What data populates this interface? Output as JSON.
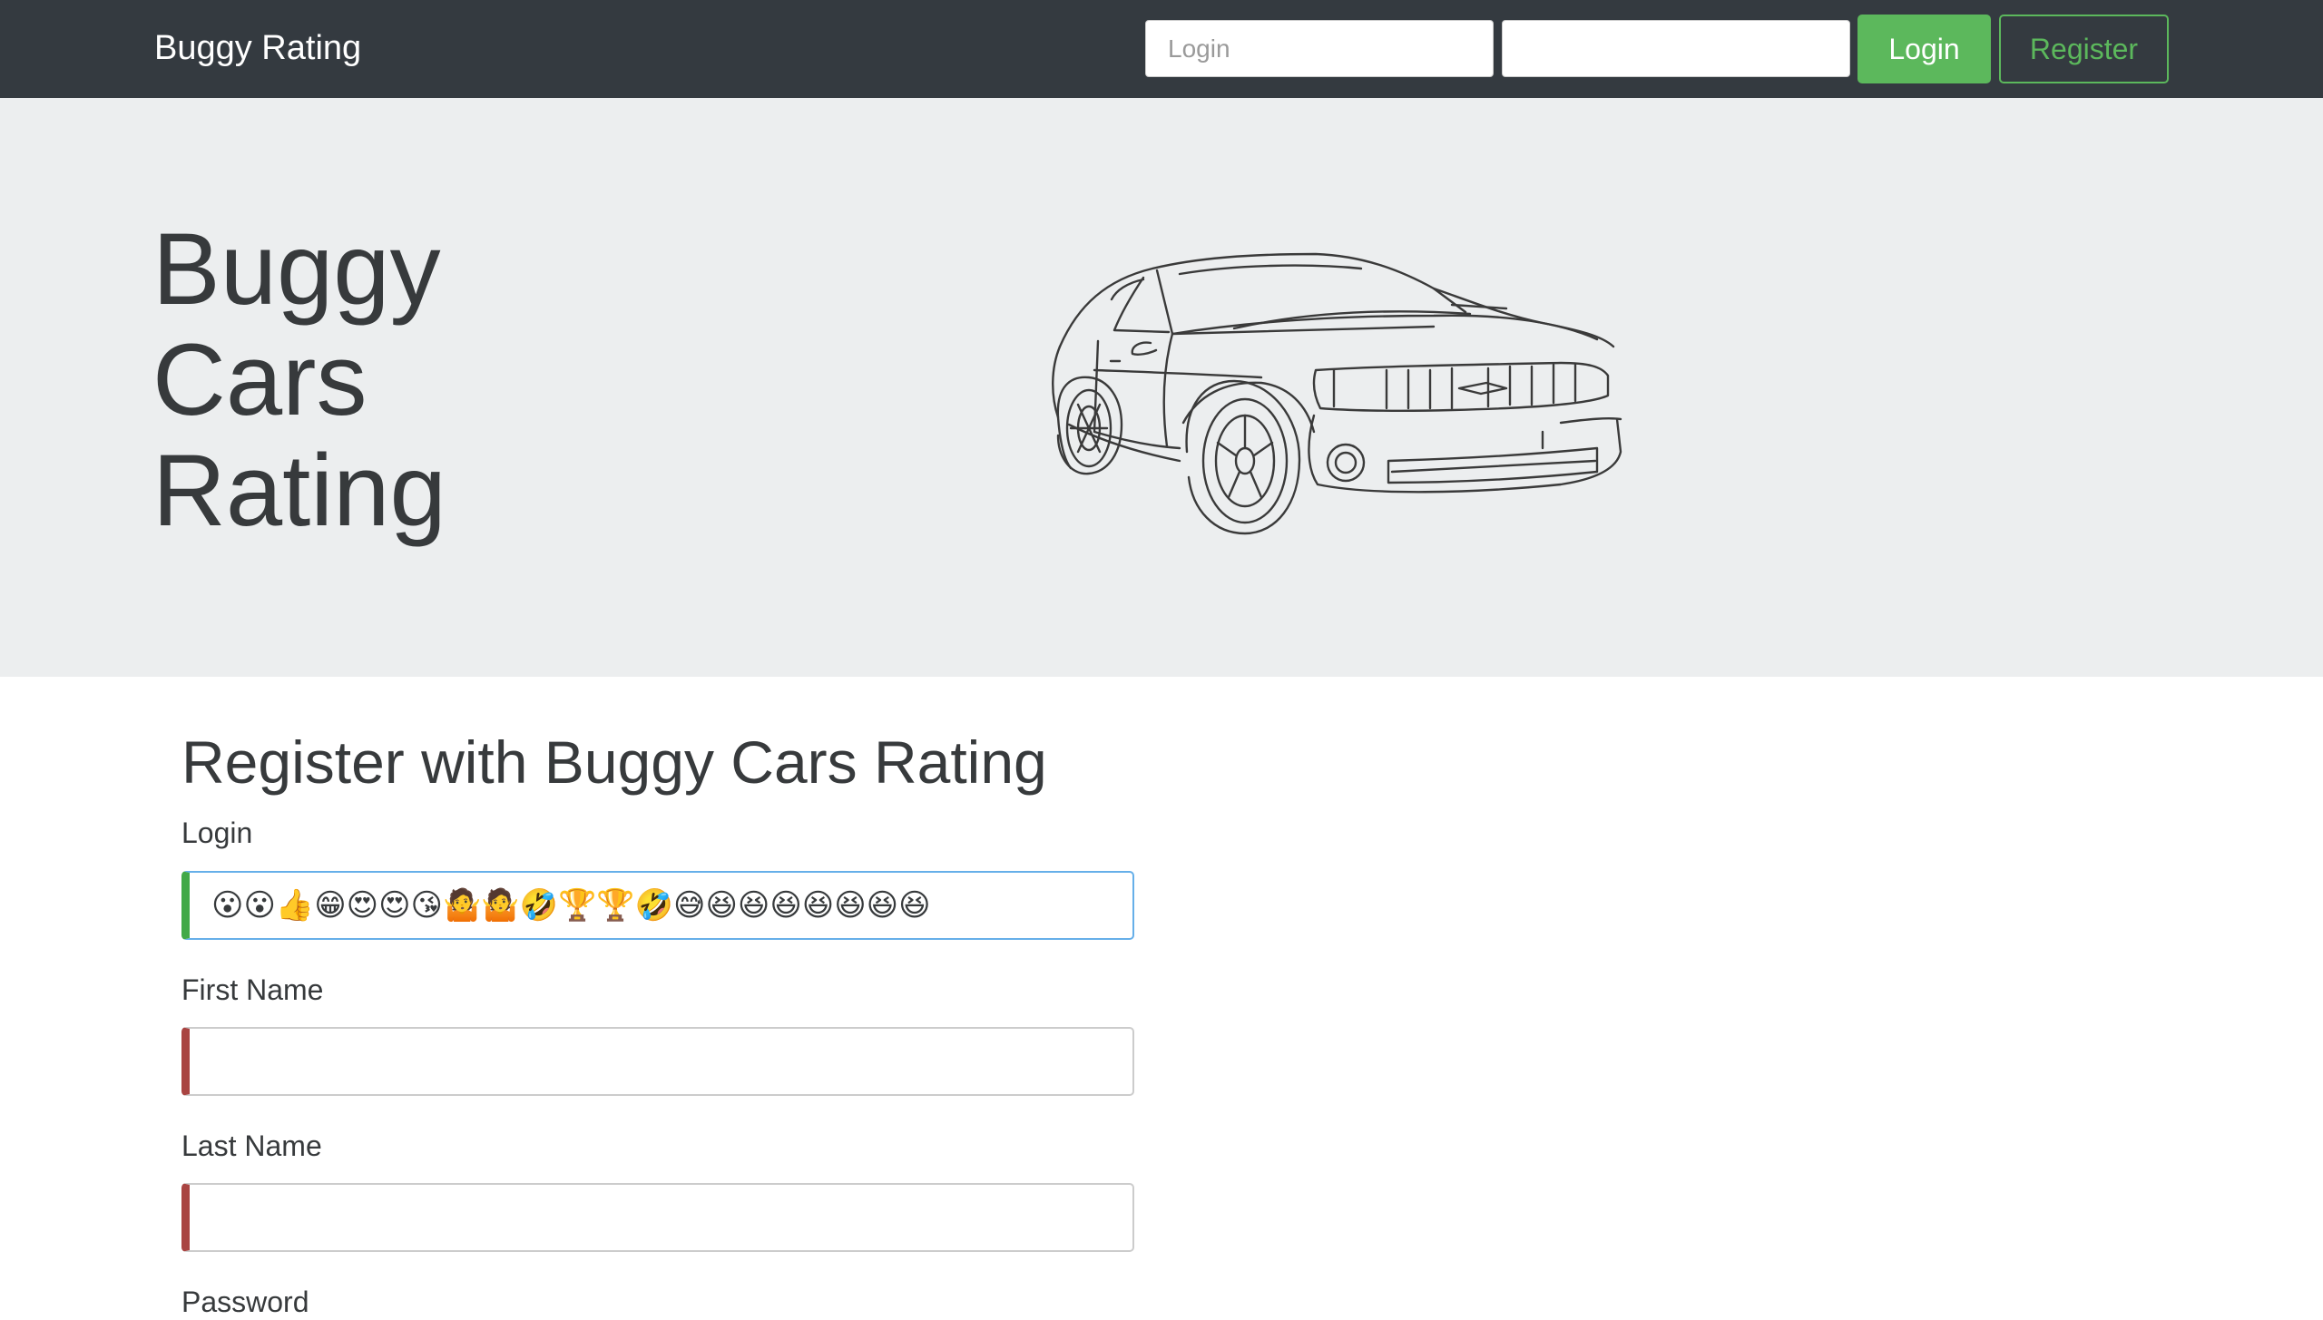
{
  "navbar": {
    "brand": "Buggy Rating",
    "login_placeholder": "Login",
    "password_value": "",
    "login_button": "Login",
    "register_button": "Register"
  },
  "hero": {
    "title_lines": [
      "Buggy",
      "Cars",
      "Rating"
    ],
    "image": "car-line-drawing"
  },
  "form": {
    "heading": "Register with Buggy Cars Rating",
    "fields": [
      {
        "label": "Login",
        "value": "😮😮👍😁😍😍😘🤷🤷🤣🏆🏆🤣😅😆😆😆😆😆😆😆",
        "state": "valid"
      },
      {
        "label": "First Name",
        "value": "",
        "state": "invalid"
      },
      {
        "label": "Last Name",
        "value": "",
        "state": "invalid"
      },
      {
        "label": "Password",
        "value": "",
        "state": "invalid"
      }
    ]
  },
  "colors": {
    "navbar_bg": "#343a40",
    "jumbotron_bg": "#eceeef",
    "success": "#5cb85c",
    "valid_indicator": "#42a948",
    "invalid_indicator": "#a94442",
    "focus_border": "#66afe9"
  }
}
